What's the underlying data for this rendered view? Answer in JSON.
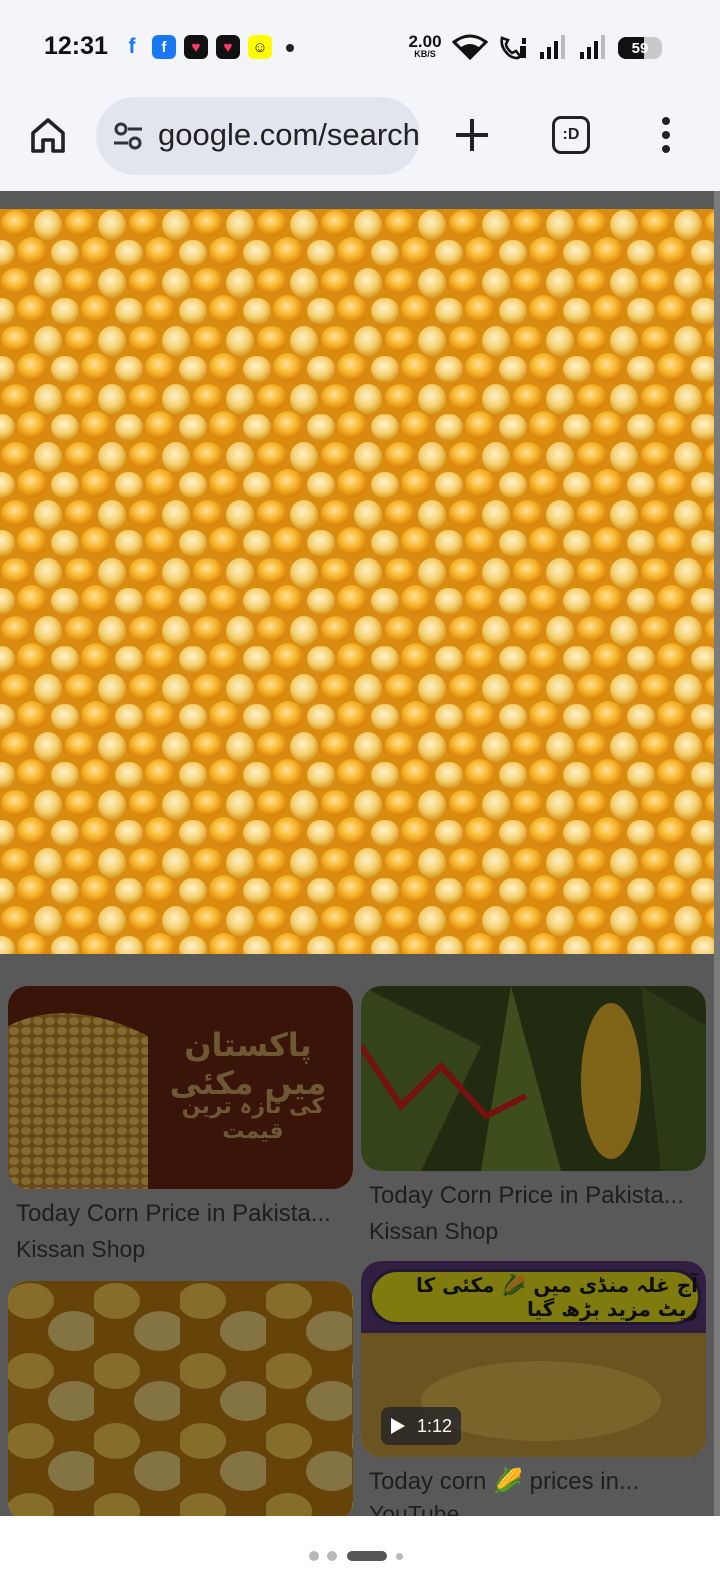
{
  "status_bar": {
    "time": "12:31",
    "notifications": [
      "facebook-icon",
      "facebook-icon",
      "heart-app-icon",
      "heart-app-icon",
      "snapchat-icon",
      "more-dot"
    ],
    "net_speed_value": "2.00",
    "net_speed_unit": "KB/S",
    "battery_level": 59,
    "battery_text": "59"
  },
  "toolbar": {
    "url": "google.com/search",
    "tabs_label": ":D",
    "icons": [
      "home-icon",
      "site-settings-icon",
      "new-tab-icon",
      "tab-switcher-icon",
      "more-vert-icon"
    ]
  },
  "results": [
    {
      "title": "Today Corn Price in Pakista...",
      "source": "Kissan Shop",
      "overlay_main": "پاکستان میں مکئی",
      "overlay_sub": "کی تازہ ترین قیمت"
    },
    {
      "title": "Today Corn Price in Pakista...",
      "source": "Kissan Shop"
    },
    {
      "title": "",
      "source": ""
    },
    {
      "title": "Today corn 🌽 prices in...",
      "source": "YouTube",
      "banner": "آج غلہ منڈی میں 🌽 مکئی کا ریٹ مزید بڑھ گیا",
      "duration": "1:12"
    }
  ],
  "colors": {
    "background": "#f4f5f9",
    "url_bar": "#e3e5ee",
    "scrim": "#595959",
    "corn": "#f3a822"
  },
  "pager": {
    "pages": 4,
    "current": 3
  }
}
